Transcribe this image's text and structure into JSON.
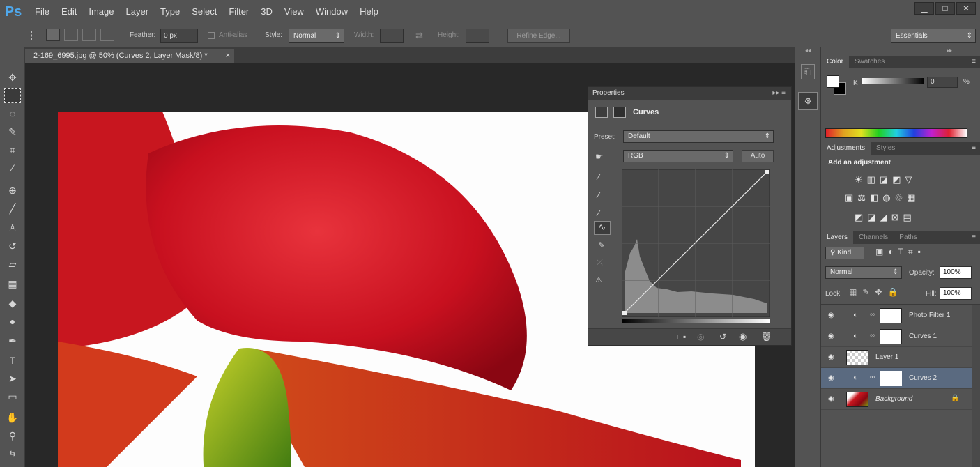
{
  "app": {
    "logo": "Ps"
  },
  "menu": [
    "File",
    "Edit",
    "Image",
    "Layer",
    "Type",
    "Select",
    "Filter",
    "3D",
    "View",
    "Window",
    "Help"
  ],
  "window_controls": [
    "▁",
    "□",
    "✕"
  ],
  "options": {
    "feather_label": "Feather:",
    "feather_value": "0 px",
    "antialias": "Anti-alias",
    "style_label": "Style:",
    "style_value": "Normal",
    "width_label": "Width:",
    "height_label": "Height:",
    "refine": "Refine Edge...",
    "workspace": "Essentials"
  },
  "document": {
    "tab": "2-169_6995.jpg @ 50% (Curves 2, Layer Mask/8) *",
    "close": "×"
  },
  "properties": {
    "title": "Properties",
    "type": "Curves",
    "preset_label": "Preset:",
    "preset_value": "Default",
    "channel": "RGB",
    "auto": "Auto"
  },
  "color_panel": {
    "tabs": [
      "Color",
      "Swatches"
    ],
    "k_label": "K",
    "k_value": "0",
    "unit": "%"
  },
  "adjustments": {
    "tabs": [
      "Adjustments",
      "Styles"
    ],
    "heading": "Add an adjustment"
  },
  "layers_panel": {
    "tabs": [
      "Layers",
      "Channels",
      "Paths"
    ],
    "kind": "Kind",
    "blend": "Normal",
    "opacity_label": "Opacity:",
    "opacity_value": "100%",
    "lock_label": "Lock:",
    "fill_label": "Fill:",
    "fill_value": "100%",
    "layers": [
      {
        "name": "Photo Filter 1"
      },
      {
        "name": "Curves 1"
      },
      {
        "name": "Layer 1"
      },
      {
        "name": "Curves 2"
      },
      {
        "name": "Background"
      }
    ]
  },
  "colors": {
    "ui_bg": "#535353",
    "panel_header": "#3c3c3c",
    "canvas_bg": "#282828",
    "selected_layer": "#5a6a80",
    "ps_blue": "#4fa8ec"
  },
  "icons": [
    "ps-logo",
    "move-tool-icon",
    "marquee-tool-icon",
    "lasso-tool-icon",
    "quick-select-icon",
    "crop-icon",
    "eyedropper-icon",
    "healing-icon",
    "brush-icon",
    "stamp-icon",
    "history-brush-icon",
    "eraser-icon",
    "gradient-icon",
    "blur-icon",
    "dodge-icon",
    "pen-icon",
    "type-icon",
    "path-select-icon",
    "shape-icon",
    "hand-icon",
    "zoom-icon",
    "eye-icon",
    "lock-icon",
    "link-icon"
  ]
}
